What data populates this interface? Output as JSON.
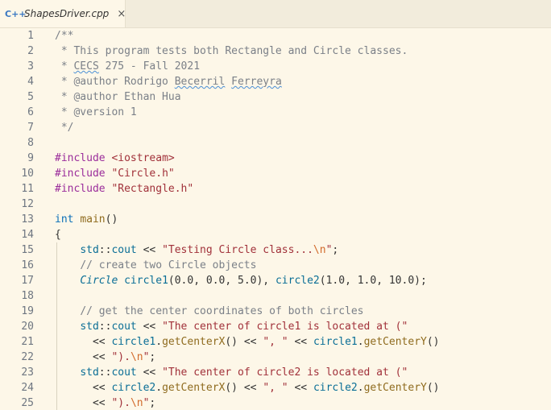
{
  "tab": {
    "icon": "C++",
    "filename": "ShapesDriver.cpp",
    "close": "×"
  },
  "lines": [
    [
      [
        "c",
        "/**"
      ]
    ],
    [
      [
        "c",
        " * This program tests both Rectangle and Circle classes."
      ]
    ],
    [
      [
        "c",
        " * "
      ],
      [
        "cs",
        "CECS"
      ],
      [
        "c",
        " 275 - Fall 2021"
      ]
    ],
    [
      [
        "c",
        " * @author Rodrigo "
      ],
      [
        "cs",
        "Becerril"
      ],
      [
        "c",
        " "
      ],
      [
        "cs",
        "Ferreyra"
      ]
    ],
    [
      [
        "c",
        " * @author Ethan Hua"
      ]
    ],
    [
      [
        "c",
        " * @version 1"
      ]
    ],
    [
      [
        "c",
        " */"
      ]
    ],
    [],
    [
      [
        "pp",
        "#include "
      ],
      [
        "str",
        "<iostream>"
      ]
    ],
    [
      [
        "pp",
        "#include "
      ],
      [
        "str",
        "\"Circle.h\""
      ]
    ],
    [
      [
        "pp",
        "#include "
      ],
      [
        "str",
        "\"Rectangle.h\""
      ]
    ],
    [],
    [
      [
        "kw",
        "int"
      ],
      [
        "plain",
        " "
      ],
      [
        "fn",
        "main"
      ],
      [
        "plain",
        "()"
      ]
    ],
    [
      [
        "plain",
        "{"
      ]
    ],
    [
      [
        "plain",
        "    "
      ],
      [
        "ns",
        "std"
      ],
      [
        "plain",
        "::"
      ],
      [
        "ns",
        "cout"
      ],
      [
        "plain",
        " << "
      ],
      [
        "str",
        "\"Testing Circle class..."
      ],
      [
        "esc",
        "\\n"
      ],
      [
        "str",
        "\""
      ],
      [
        "plain",
        ";"
      ]
    ],
    [
      [
        "plain",
        "    "
      ],
      [
        "c",
        "// create two Circle objects"
      ]
    ],
    [
      [
        "plain",
        "    "
      ],
      [
        "ty",
        "Circle"
      ],
      [
        "plain",
        " "
      ],
      [
        "ns",
        "circle1"
      ],
      [
        "plain",
        "(0.0, 0.0, 5.0), "
      ],
      [
        "ns",
        "circle2"
      ],
      [
        "plain",
        "(1.0, 1.0, 10.0);"
      ]
    ],
    [],
    [
      [
        "plain",
        "    "
      ],
      [
        "c",
        "// get the center coordinates of both circles"
      ]
    ],
    [
      [
        "plain",
        "    "
      ],
      [
        "ns",
        "std"
      ],
      [
        "plain",
        "::"
      ],
      [
        "ns",
        "cout"
      ],
      [
        "plain",
        " << "
      ],
      [
        "str",
        "\"The center of circle1 is located at (\""
      ]
    ],
    [
      [
        "plain",
        "      << "
      ],
      [
        "ns",
        "circle1"
      ],
      [
        "plain",
        "."
      ],
      [
        "fn",
        "getCenterX"
      ],
      [
        "plain",
        "() << "
      ],
      [
        "str",
        "\", \""
      ],
      [
        "plain",
        " << "
      ],
      [
        "ns",
        "circle1"
      ],
      [
        "plain",
        "."
      ],
      [
        "fn",
        "getCenterY"
      ],
      [
        "plain",
        "()"
      ]
    ],
    [
      [
        "plain",
        "      << "
      ],
      [
        "str",
        "\")."
      ],
      [
        "esc",
        "\\n"
      ],
      [
        "str",
        "\""
      ],
      [
        "plain",
        ";"
      ]
    ],
    [
      [
        "plain",
        "    "
      ],
      [
        "ns",
        "std"
      ],
      [
        "plain",
        "::"
      ],
      [
        "ns",
        "cout"
      ],
      [
        "plain",
        " << "
      ],
      [
        "str",
        "\"The center of circle2 is located at (\""
      ]
    ],
    [
      [
        "plain",
        "      << "
      ],
      [
        "ns",
        "circle2"
      ],
      [
        "plain",
        "."
      ],
      [
        "fn",
        "getCenterX"
      ],
      [
        "plain",
        "() << "
      ],
      [
        "str",
        "\", \""
      ],
      [
        "plain",
        " << "
      ],
      [
        "ns",
        "circle2"
      ],
      [
        "plain",
        "."
      ],
      [
        "fn",
        "getCenterY"
      ],
      [
        "plain",
        "()"
      ]
    ],
    [
      [
        "plain",
        "      << "
      ],
      [
        "str",
        "\")."
      ],
      [
        "esc",
        "\\n"
      ],
      [
        "str",
        "\""
      ],
      [
        "plain",
        ";"
      ]
    ]
  ]
}
